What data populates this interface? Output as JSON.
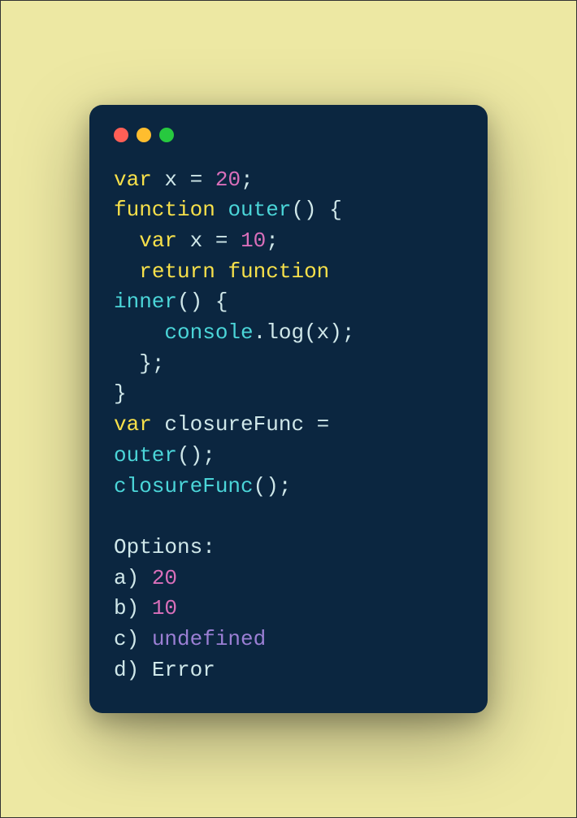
{
  "code": {
    "line1": {
      "kw": "var",
      "sp1": " x ",
      "eq": "= ",
      "num": "20",
      "end": ";"
    },
    "line2": {
      "kw": "function",
      "sp": " ",
      "name": "outer",
      "parens": "() {"
    },
    "line3": {
      "indent": "  ",
      "kw": "var",
      "sp": " x ",
      "eq": "= ",
      "num": "10",
      "end": ";"
    },
    "line4": {
      "indent": "  ",
      "kw": "return",
      "sp": " ",
      "kw2": "function"
    },
    "line5": {
      "name": "inner",
      "parens": "() {"
    },
    "line6": {
      "indent": "    ",
      "obj": "console",
      "dot": ".",
      "method": "log",
      "open": "(",
      "arg": "x",
      "close": ");"
    },
    "line7": {
      "indent": "  ",
      "text": "};"
    },
    "line8": {
      "text": "}"
    },
    "line9": {
      "kw": "var",
      "sp": " closureFunc ",
      "eq": "="
    },
    "line10": {
      "name": "outer",
      "parens": "();"
    },
    "line11": {
      "name": "closureFunc",
      "parens": "();"
    },
    "blank": "",
    "options": {
      "label": "Options:",
      "a": {
        "prefix": "a) ",
        "val": "20"
      },
      "b": {
        "prefix": "b) ",
        "val": "10"
      },
      "c": {
        "prefix": "c) ",
        "val": "undefined"
      },
      "d": {
        "prefix": "d) ",
        "val": "Error"
      }
    }
  }
}
